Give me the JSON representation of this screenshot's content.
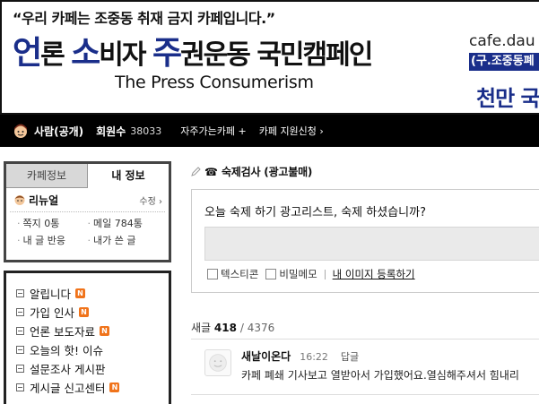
{
  "banner": {
    "quote": "“우리 카페는 조중동 취재 금지 카페입니다.”",
    "title_1_big": "언",
    "title_1_small": "론 ",
    "title_2_big": "소",
    "title_2_small": "비자 ",
    "title_3_big": "주",
    "title_3_small": "권운동 국민캠페인",
    "subtitle": "The Press Consumerism",
    "url": "cafe.dau",
    "url_box": "(구.조중동폐",
    "million": "천만 국"
  },
  "navbar": {
    "level_label": "사람(공개)",
    "members_label": "회원수",
    "members_count": "38033",
    "link_frequent": "자주가는카페 +",
    "link_apply": "카페 지원신청 ›"
  },
  "sidebar": {
    "tabs": [
      "카페정보",
      "내 정보"
    ],
    "user_name": "리뉴얼",
    "edit_label": "수정 ›",
    "stats": [
      [
        "쪽지 0통",
        "메일 784통"
      ],
      [
        "내 글 반응",
        "내가 쓴 글"
      ]
    ],
    "menu": [
      {
        "label": "알립니다",
        "new": "N"
      },
      {
        "label": "가입 인사",
        "new": "N"
      },
      {
        "label": "언론 보도자료",
        "new": "N"
      },
      {
        "label": "오늘의 핫! 이슈",
        "new": ""
      },
      {
        "label": "설문조사 게시판",
        "new": ""
      },
      {
        "label": "게시글 신고센터",
        "new": "N"
      }
    ]
  },
  "main": {
    "board_title": "숙제검사 (광고불매)",
    "survey_question": "오늘 숙제 하기 광고리스트, 숙제 하셨습니까?",
    "option_text": "텍스티콘",
    "option_secret": "비밀메모",
    "image_link": "내 이미지 등록하기",
    "new_label": "새글",
    "new_count": "418",
    "total": "4376",
    "comment": {
      "author": "새날이온다",
      "time": "16:22",
      "reply": "답글",
      "body": "카페 폐쇄 기사보고 열받아서 가입했어요.열심해주셔서 힘내리"
    }
  },
  "colors": {
    "banner_blue": "#1a2e8a",
    "navbar_bg": "#000000",
    "new_badge": "#f0731a"
  }
}
